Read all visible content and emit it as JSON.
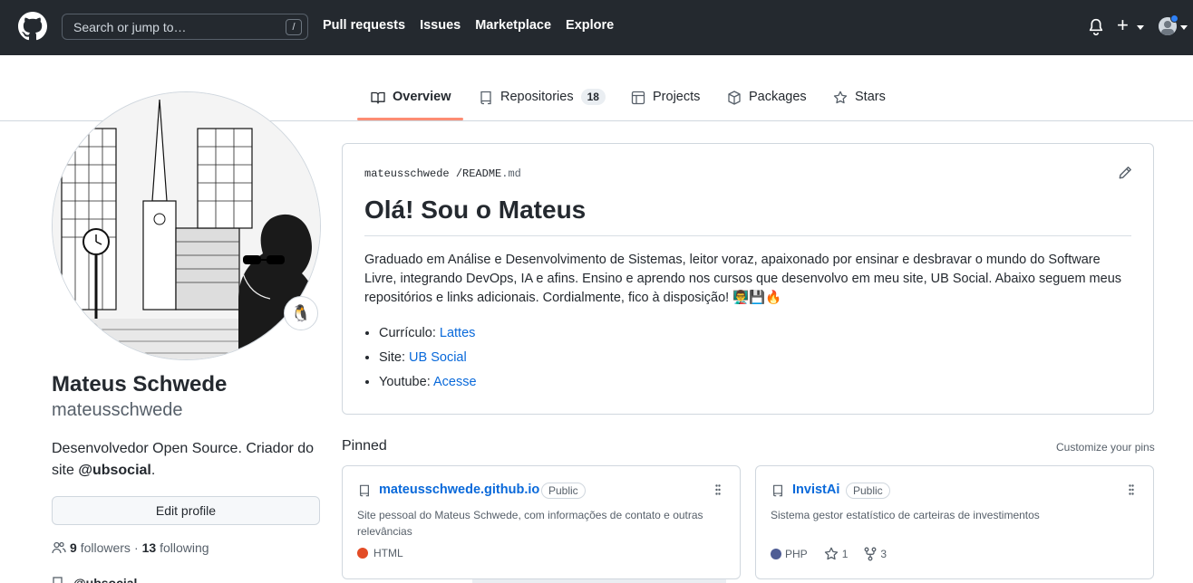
{
  "header": {
    "search_placeholder": "Search or jump to…",
    "search_shortcut": "/",
    "nav": [
      "Pull requests",
      "Issues",
      "Marketplace",
      "Explore"
    ],
    "new_button": "+"
  },
  "tabs": [
    {
      "label": "Overview",
      "active": true
    },
    {
      "label": "Repositories",
      "count": "18"
    },
    {
      "label": "Projects"
    },
    {
      "label": "Packages"
    },
    {
      "label": "Stars"
    }
  ],
  "profile": {
    "name": "Mateus Schwede",
    "login": "mateusschwede",
    "bio_text": "Desenvolvedor Open Source. Criador do site ",
    "bio_mention": "@ubsocial",
    "bio_end": ".",
    "edit_button": "Edit profile",
    "followers_count": "9",
    "followers_label": "followers",
    "separator": "·",
    "following_count": "13",
    "following_label": "following",
    "org": "@ubsocial",
    "status_emoji": "🐧"
  },
  "readme": {
    "path_user": "mateusschwede",
    "path_sep": "/",
    "path_file": "README",
    "path_ext": ".md",
    "title": "Olá! Sou o Mateus",
    "body": "Graduado em Análise e Desenvolvimento de Sistemas, leitor voraz, apaixonado por ensinar e desbravar o mundo do Software Livre, integrando DevOps, IA e afins. Ensino e aprendo nos cursos que desenvolvo em meu site, UB Social. Abaixo seguem meus repositórios e links adicionais. Cordialmente, fico à disposição! 👨‍🏫💾🔥",
    "links": [
      {
        "label": "Currículo: ",
        "link": "Lattes"
      },
      {
        "label": "Site: ",
        "link": "UB Social"
      },
      {
        "label": "Youtube: ",
        "link": "Acesse"
      }
    ]
  },
  "pinned": {
    "title": "Pinned",
    "customize": "Customize your pins",
    "repos": [
      {
        "name": "mateusschwede.github.io",
        "visibility": "Public",
        "description": "Site pessoal do Mateus Schwede, com informações de contato e outras relevâncias",
        "language": "HTML",
        "language_color": "#e34c26"
      },
      {
        "name": "InvistAi",
        "visibility": "Public",
        "description": "Sistema gestor estatístico de carteiras de investimentos",
        "language": "PHP",
        "language_color": "#4F5D95",
        "stars": "1",
        "forks": "3"
      }
    ]
  }
}
